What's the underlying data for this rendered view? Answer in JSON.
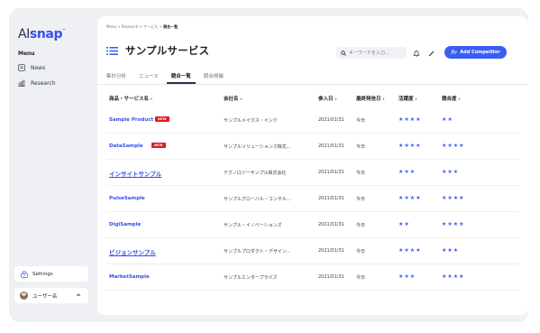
{
  "app": {
    "logo_ai": "AI",
    "logo_snap": "snap",
    "logo_tm": "™"
  },
  "sidebar": {
    "menu_label": "Menu",
    "items": [
      {
        "label": "News",
        "icon": "news-icon"
      },
      {
        "label": "Research",
        "icon": "chart-icon"
      }
    ],
    "settings_label": "Settings",
    "user_label": "ユーザー名"
  },
  "breadcrumb": {
    "parts": [
      "Menu",
      "Research",
      "サービス"
    ],
    "separator": ">",
    "current": "競合一覧"
  },
  "header": {
    "title": "サンプルサービス",
    "search_placeholder": "キーワードを入力...",
    "add_button": "Add Competitor"
  },
  "tabs": [
    {
      "label": "集計分析",
      "active": false
    },
    {
      "label": "ニュース",
      "active": false
    },
    {
      "label": "競合一覧",
      "active": true
    },
    {
      "label": "競合候補",
      "active": false
    }
  ],
  "table": {
    "columns": [
      "商品・サービス名",
      "会社名",
      "参入日",
      "最終発信日",
      "活躍度",
      "競合度"
    ],
    "rows": [
      {
        "product": "Sample Product",
        "new": true,
        "badge": "NEW",
        "company": "サンプルメイクス・インク",
        "entry": "2021/01/31",
        "last": "今日",
        "activity": "★★★★",
        "competition": "★★"
      },
      {
        "product": "DataSample",
        "new": true,
        "badge": "NEW",
        "company": "サンプルソリューションズ株式...",
        "entry": "2021/01/31",
        "last": "今日",
        "activity": "★★★★",
        "competition": "★★★★"
      },
      {
        "product": "インサイトサンプル",
        "new": false,
        "badge": "",
        "company": "テクノロジーサンプル株式会社",
        "entry": "2021/01/31",
        "last": "今日",
        "activity": "★★★",
        "competition": "★★★"
      },
      {
        "product": "PulseSample",
        "new": false,
        "badge": "",
        "company": "サンプルグローバル・コンサル...",
        "entry": "2021/01/31",
        "last": "今日",
        "activity": "★★★★",
        "competition": "★★★★"
      },
      {
        "product": "DigiSample",
        "new": false,
        "badge": "",
        "company": "サンプル・イノベーションズ",
        "entry": "2021/01/31",
        "last": "今日",
        "activity": "★★",
        "competition": "★★★★"
      },
      {
        "product": "ビジョンサンプル",
        "new": false,
        "badge": "",
        "company": "サンプルプロダクト・デザイン...",
        "entry": "2021/01/31",
        "last": "今日",
        "activity": "★★★★",
        "competition": "★★★"
      },
      {
        "product": "MarketSample",
        "new": false,
        "badge": "",
        "company": "サンプルエンタープライズ",
        "entry": "2021/01/31",
        "last": "今日",
        "activity": "★★★",
        "competition": "★★★★"
      }
    ]
  },
  "colors": {
    "accent": "#3b5ef0",
    "new_badge": "#e01b24",
    "background": "#eef0f4"
  }
}
